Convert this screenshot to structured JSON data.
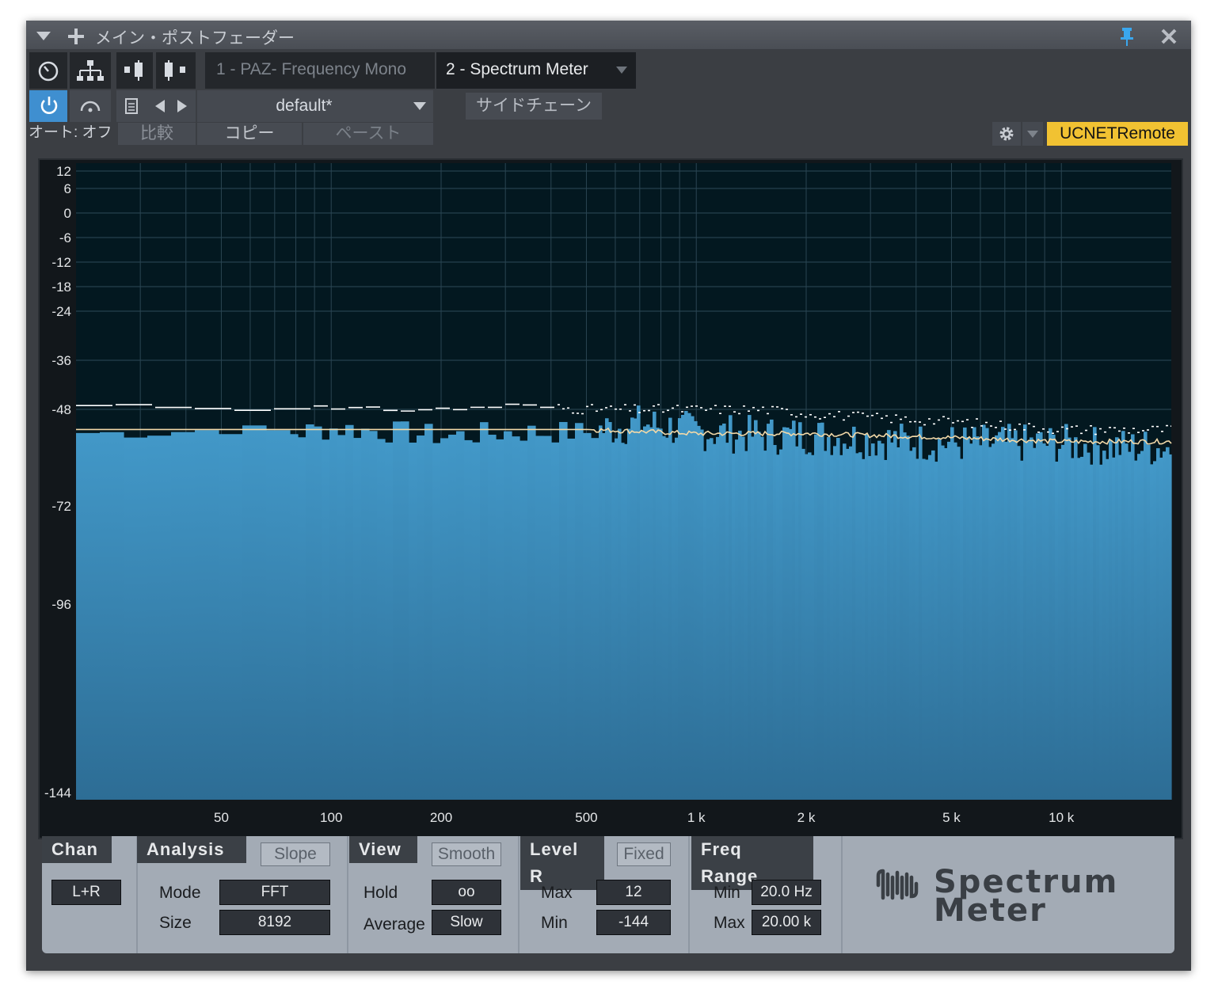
{
  "window": {
    "title": "メイン・ポストフェーダー",
    "menu_icon": "chevron-down-icon",
    "add_icon": "plus-icon",
    "pin_icon": "pin-icon",
    "close_icon": "close-icon"
  },
  "plugin_tabs": [
    {
      "label": "1 - PAZ- Frequency Mono",
      "active": false
    },
    {
      "label": "2 - Spectrum Meter",
      "active": true
    }
  ],
  "preset": {
    "name": "default*",
    "sidechain_label": "サイドチェーン"
  },
  "automation": {
    "auto_label": "オート: オフ",
    "compare_label": "比較",
    "copy_label": "コピー",
    "paste_label": "ペースト"
  },
  "remote_label": "UCNETRemote",
  "accent_colors": {
    "remote": "#f1c232",
    "power": "#3f8fd0",
    "spectrum": "#3f93c2",
    "peak": "#ffffff",
    "average": "#f3d9a8"
  },
  "graph": {
    "y_labels": [
      "12",
      "6",
      "0",
      "-6",
      "-12",
      "-18",
      "-24",
      "-36",
      "-48",
      "-72",
      "-96",
      "-144"
    ],
    "x_labels": [
      "50",
      "100",
      "200",
      "500",
      "1 k",
      "2 k",
      "5 k",
      "10 k"
    ]
  },
  "chart_data": {
    "type": "area",
    "x_scale": "log",
    "xlim": [
      20,
      20000
    ],
    "x_ticks": [
      50,
      100,
      200,
      500,
      1000,
      2000,
      5000,
      10000
    ],
    "y_ticks": [
      12,
      6,
      0,
      -6,
      -12,
      -18,
      -24,
      -36,
      -48,
      -72,
      -96,
      -144
    ],
    "ylim": [
      -144,
      12
    ],
    "grid": true,
    "series": [
      {
        "x": [
          20,
          30,
          50,
          80,
          100,
          150,
          200,
          300,
          500,
          700,
          1000,
          1500,
          2000,
          3000,
          5000,
          7000,
          10000,
          15000,
          20000
        ],
        "values": [
          -54,
          -54,
          -53,
          -54,
          -53,
          -54,
          -55,
          -54,
          -54,
          -52,
          -54,
          -55,
          -55,
          -56,
          -57,
          -57,
          -57,
          -58,
          -58
        ]
      },
      {
        "x": [
          20,
          30,
          50,
          80,
          100,
          150,
          200,
          300,
          500,
          700,
          1000,
          1500,
          2000,
          3000,
          5000,
          7000,
          10000,
          15000,
          20000
        ],
        "values": [
          -47,
          -47,
          -48,
          -47,
          -48,
          -48,
          -48,
          -47,
          -48,
          -48,
          -48,
          -48,
          -49,
          -50,
          -51,
          -52,
          -53,
          -53,
          -53
        ]
      },
      {
        "x": [
          20,
          50,
          100,
          200,
          500,
          1000,
          2000,
          5000,
          10000,
          20000
        ],
        "values": [
          -53,
          -53,
          -53,
          -53,
          -53,
          -54,
          -54,
          -55,
          -56,
          -56
        ]
      }
    ]
  },
  "panel": {
    "chan": {
      "tab": "Chan",
      "value": "L+R"
    },
    "analysis": {
      "tab": "Analysis",
      "slope": "Slope",
      "mode_label": "Mode",
      "mode_value": "FFT",
      "size_label": "Size",
      "size_value": "8192"
    },
    "view": {
      "tab": "View",
      "smooth": "Smooth",
      "hold_label": "Hold",
      "hold_value": "oo",
      "average_label": "Average",
      "average_value": "Slow"
    },
    "level": {
      "tab": "Level R",
      "fixed": "Fixed",
      "max_label": "Max",
      "max_value": "12",
      "min_label": "Min",
      "min_value": "-144"
    },
    "freq": {
      "tab": "Freq Range",
      "min_label": "Min",
      "min_value": "20.0 Hz",
      "max_label": "Max",
      "max_value": "20.00 k"
    },
    "logo_line1": "Spectrum",
    "logo_line2": "Meter"
  }
}
